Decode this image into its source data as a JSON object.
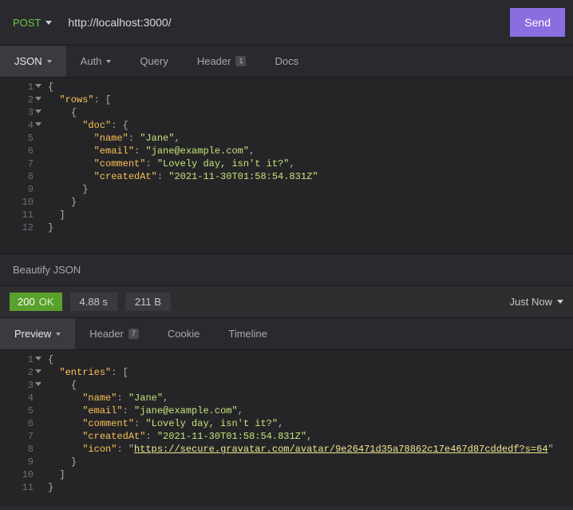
{
  "request": {
    "method": "POST",
    "url": "http://localhost:3000/",
    "send_label": "Send"
  },
  "request_tabs": {
    "body_type": "JSON",
    "auth": "Auth",
    "query": "Query",
    "header": "Header",
    "header_badge": "1",
    "docs": "Docs"
  },
  "request_body": {
    "lines": [
      {
        "n": 1,
        "fold": true,
        "indent": 0,
        "tokens": [
          [
            "punc",
            "{"
          ]
        ]
      },
      {
        "n": 2,
        "fold": true,
        "indent": 1,
        "tokens": [
          [
            "key",
            "\"rows\""
          ],
          [
            "punc",
            ": ["
          ]
        ]
      },
      {
        "n": 3,
        "fold": true,
        "indent": 2,
        "tokens": [
          [
            "punc",
            "{"
          ]
        ]
      },
      {
        "n": 4,
        "fold": true,
        "indent": 3,
        "tokens": [
          [
            "key",
            "\"doc\""
          ],
          [
            "punc",
            ": {"
          ]
        ]
      },
      {
        "n": 5,
        "indent": 4,
        "tokens": [
          [
            "key",
            "\"name\""
          ],
          [
            "punc",
            ": "
          ],
          [
            "str",
            "\"Jane\""
          ],
          [
            "punc",
            ","
          ]
        ]
      },
      {
        "n": 6,
        "indent": 4,
        "tokens": [
          [
            "key",
            "\"email\""
          ],
          [
            "punc",
            ": "
          ],
          [
            "str",
            "\"jane@example.com\""
          ],
          [
            "punc",
            ","
          ]
        ]
      },
      {
        "n": 7,
        "indent": 4,
        "tokens": [
          [
            "key",
            "\"comment\""
          ],
          [
            "punc",
            ": "
          ],
          [
            "str",
            "\"Lovely day, isn't it?\""
          ],
          [
            "punc",
            ","
          ]
        ]
      },
      {
        "n": 8,
        "indent": 4,
        "tokens": [
          [
            "key",
            "\"createdAt\""
          ],
          [
            "punc",
            ": "
          ],
          [
            "str",
            "\"2021-11-30T01:58:54.831Z\""
          ]
        ]
      },
      {
        "n": 9,
        "indent": 3,
        "tokens": [
          [
            "punc",
            "}"
          ]
        ]
      },
      {
        "n": 10,
        "indent": 2,
        "tokens": [
          [
            "punc",
            "}"
          ]
        ]
      },
      {
        "n": 11,
        "indent": 1,
        "tokens": [
          [
            "punc",
            "]"
          ]
        ]
      },
      {
        "n": 12,
        "indent": 0,
        "tokens": [
          [
            "punc",
            "}"
          ]
        ]
      }
    ]
  },
  "beautify_label": "Beautify JSON",
  "status": {
    "code": "200",
    "text": "OK",
    "time": "4.88 s",
    "size": "211 B",
    "justnow": "Just Now"
  },
  "response_tabs": {
    "preview": "Preview",
    "header": "Header",
    "header_badge": "7",
    "cookie": "Cookie",
    "timeline": "Timeline"
  },
  "response_body": {
    "lines": [
      {
        "n": 1,
        "fold": true,
        "indent": 0,
        "tokens": [
          [
            "punc",
            "{"
          ]
        ]
      },
      {
        "n": 2,
        "fold": true,
        "indent": 1,
        "tokens": [
          [
            "key",
            "\"entries\""
          ],
          [
            "punc",
            ": ["
          ]
        ]
      },
      {
        "n": 3,
        "fold": true,
        "indent": 2,
        "tokens": [
          [
            "punc",
            "{"
          ]
        ]
      },
      {
        "n": 4,
        "indent": 3,
        "tokens": [
          [
            "key",
            "\"name\""
          ],
          [
            "punc",
            ": "
          ],
          [
            "str",
            "\"Jane\""
          ],
          [
            "punc",
            ","
          ]
        ]
      },
      {
        "n": 5,
        "indent": 3,
        "tokens": [
          [
            "key",
            "\"email\""
          ],
          [
            "punc",
            ": "
          ],
          [
            "str",
            "\"jane@example.com\""
          ],
          [
            "punc",
            ","
          ]
        ]
      },
      {
        "n": 6,
        "indent": 3,
        "tokens": [
          [
            "key",
            "\"comment\""
          ],
          [
            "punc",
            ": "
          ],
          [
            "str",
            "\"Lovely day, isn't it?\""
          ],
          [
            "punc",
            ","
          ]
        ]
      },
      {
        "n": 7,
        "indent": 3,
        "tokens": [
          [
            "key",
            "\"createdAt\""
          ],
          [
            "punc",
            ": "
          ],
          [
            "str",
            "\"2021-11-30T01:58:54.831Z\""
          ],
          [
            "punc",
            ","
          ]
        ]
      },
      {
        "n": 8,
        "indent": 3,
        "tokens": [
          [
            "key",
            "\"icon\""
          ],
          [
            "punc",
            ": \""
          ],
          [
            "link",
            "https://secure.gravatar.com/avatar/9e26471d35a78862c17e467d87cddedf?s=64"
          ],
          [
            "punc",
            "\""
          ]
        ]
      },
      {
        "n": 9,
        "indent": 2,
        "tokens": [
          [
            "punc",
            "}"
          ]
        ]
      },
      {
        "n": 10,
        "indent": 1,
        "tokens": [
          [
            "punc",
            "]"
          ]
        ]
      },
      {
        "n": 11,
        "indent": 0,
        "tokens": [
          [
            "punc",
            "}"
          ]
        ]
      }
    ]
  }
}
